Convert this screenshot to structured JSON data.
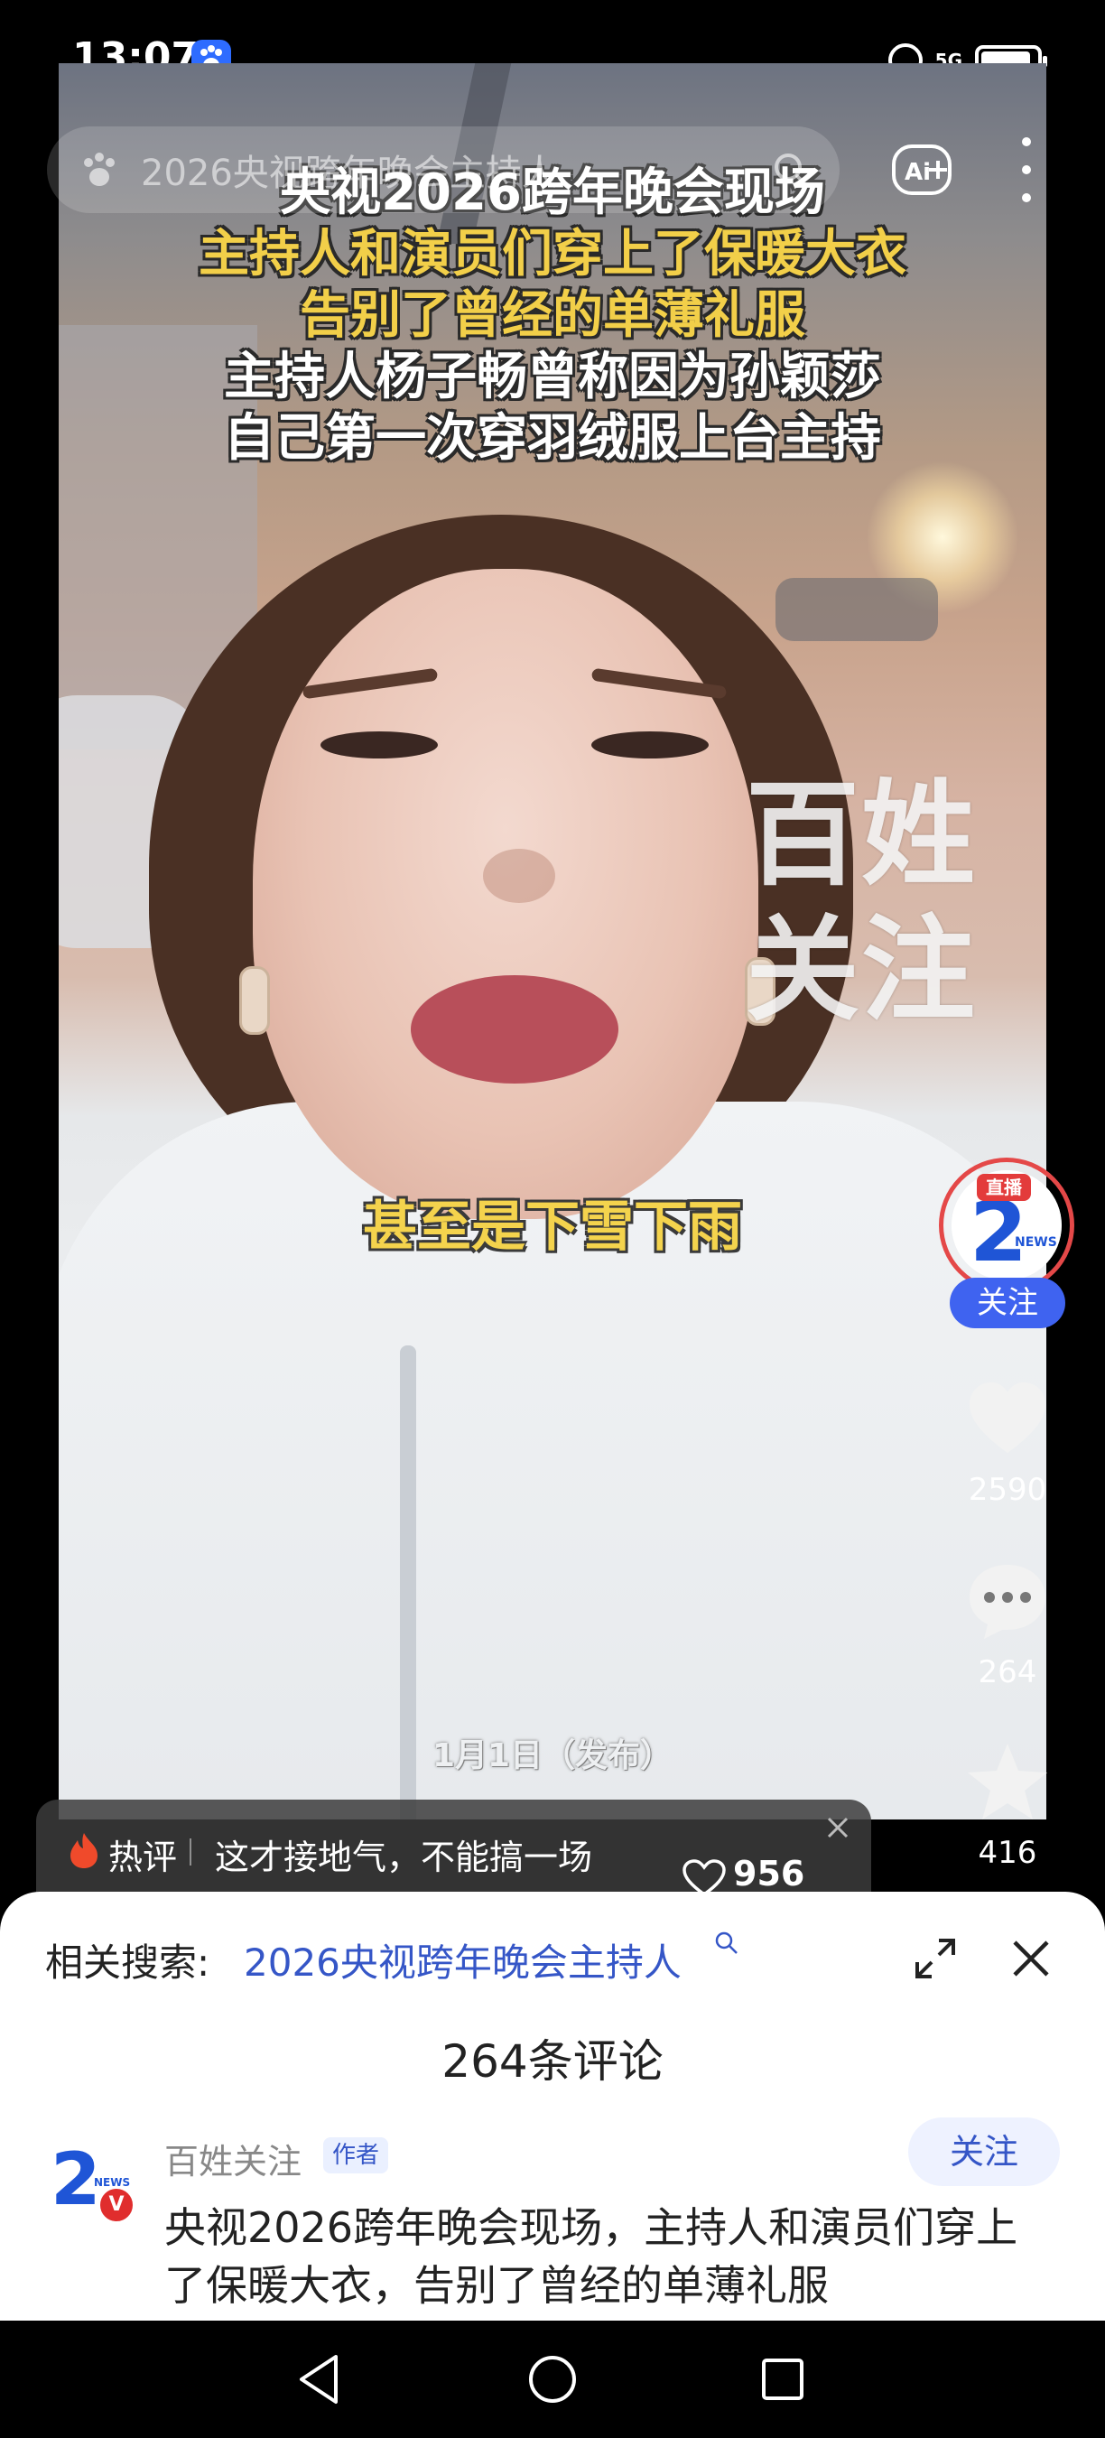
{
  "status_bar": {
    "time": "13:07",
    "network": "5G",
    "battery_level": 0.9
  },
  "top_bar": {
    "search_text": "2026央视跨年晚会主持人"
  },
  "video": {
    "caption_lines": [
      "央视2026跨年晚会现场",
      "主持人和演员们穿上了保暖大衣",
      "告别了曾经的单薄礼服",
      "主持人杨子畅曾称因为孙颖莎",
      "自己第一次穿羽绒服上台主持"
    ],
    "subtitle": "甚至是下雪下雨",
    "watermark_lines": [
      "百姓",
      "关注"
    ],
    "publish_date": "1月1日（发布）"
  },
  "side_actions": {
    "live_badge": "直播",
    "follow_label": "关注",
    "likes": "2590",
    "comments": "264",
    "favorites": "416"
  },
  "hot_comment": {
    "label": "热评",
    "text": "这才接地气，不能搞一场",
    "likes": "956"
  },
  "comment_sheet": {
    "related_label": "相关搜索:",
    "related_query": "2026央视跨年晚会主持人",
    "count_title": "264条评论",
    "author_name": "百姓关注",
    "author_tag": "作者",
    "follow_label": "关注",
    "text": "央视2026跨年晚会现场，主持人和演员们穿上了保暖大衣，告别了曾经的单薄礼服"
  },
  "colors": {
    "caption_yellow": "#f2cf49",
    "accent_blue": "#3f63f0",
    "link_blue": "#3556c7",
    "live_red": "#e33b3b"
  }
}
